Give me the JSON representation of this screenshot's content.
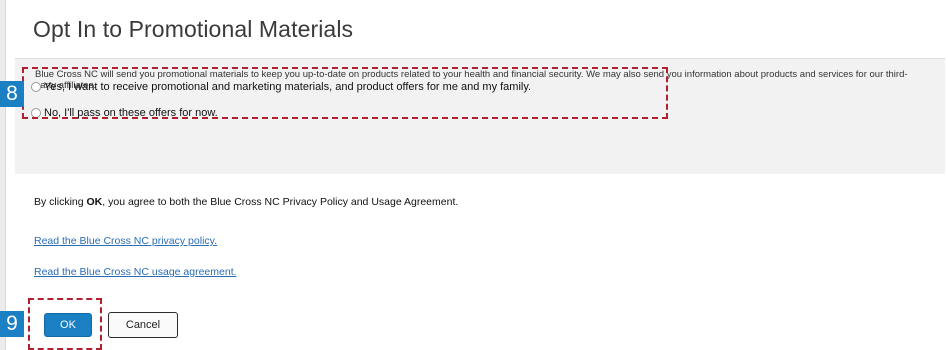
{
  "page_title": "Opt In to Promotional Materials",
  "promo": {
    "description": "Blue Cross NC will send you promotional materials to keep you up-to-date on products related to your health and financial security. We may also send you information about products and services for our third-party affiliates.",
    "options": [
      {
        "label": "Yes, I want to receive promotional and marketing materials, and product offers for me and my family.",
        "selected": false
      },
      {
        "label": "No, I'll pass on these offers for now.",
        "selected": false
      }
    ]
  },
  "agreement": {
    "prefix": "By clicking ",
    "bold": "OK",
    "suffix": ", you agree to both the Blue Cross NC Privacy Policy and Usage Agreement."
  },
  "links": {
    "privacy": "Read the Blue Cross NC privacy policy.",
    "usage": "Read the Blue Cross NC usage agreement."
  },
  "buttons": {
    "ok": "OK",
    "cancel": "Cancel"
  },
  "callouts": {
    "step_8": "8",
    "step_9": "9"
  },
  "colors": {
    "accent": "#1a7fc3",
    "callout_border": "#b0202e",
    "link": "#2a6db5"
  }
}
